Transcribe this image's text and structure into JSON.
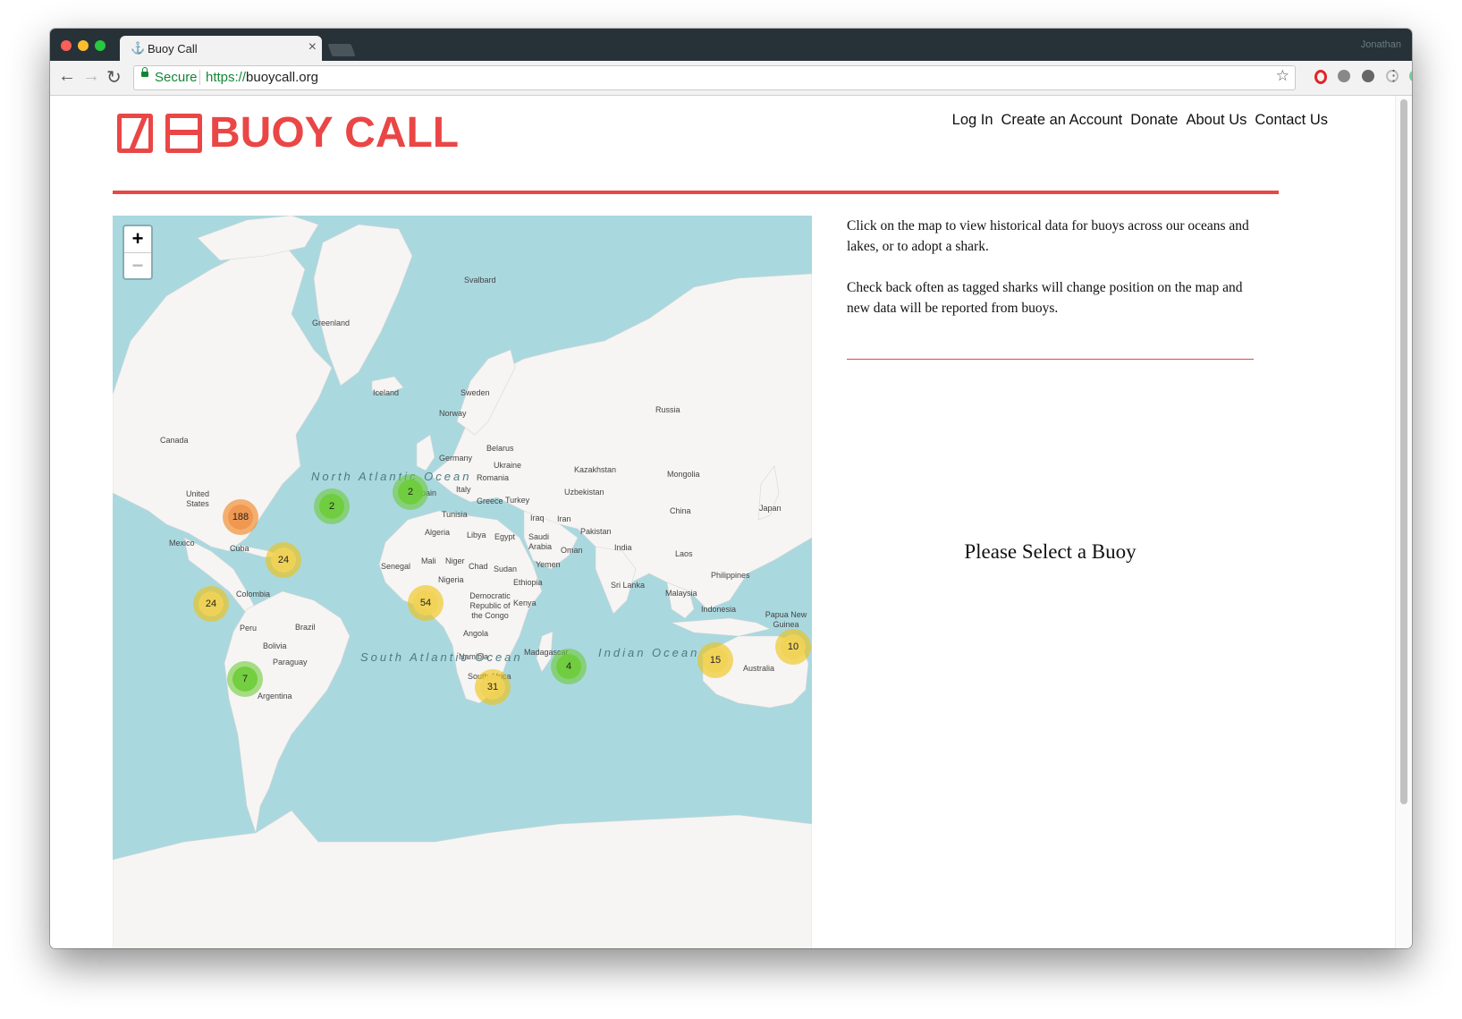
{
  "browser": {
    "tab_title": "Buoy Call",
    "secure_label": "Secure",
    "url_scheme": "https://",
    "url_host": "buoycall.org",
    "profile_name": "Jonathan"
  },
  "header": {
    "logo_text": "BUOY CALL",
    "nav": [
      "Log In",
      "Create an Account",
      "Donate",
      "About Us",
      "Contact Us"
    ],
    "accent_color": "#ea4646"
  },
  "map": {
    "zoom_in": "+",
    "zoom_out": "−",
    "labels": [
      "Svalbard",
      "Greenland",
      "Iceland",
      "Sweden",
      "Norway",
      "Russia",
      "Canada",
      "Belarus",
      "Germany",
      "Ukraine",
      "Romania",
      "Kazakhstan",
      "Mongolia",
      "Italy",
      "Uzbekistan",
      "Spain",
      "Greece",
      "Turkey",
      "United States",
      "Tunisia",
      "Iraq",
      "Iran",
      "China",
      "Japan",
      "Algeria",
      "Libya",
      "Egypt",
      "Saudi Arabia",
      "Pakistan",
      "Mexico",
      "Cuba",
      "Oman",
      "India",
      "Laos",
      "Senegal",
      "Mali",
      "Niger",
      "Chad",
      "Sudan",
      "Yemen",
      "Colombia",
      "Nigeria",
      "Ethiopia",
      "Sri Lanka",
      "Philippines",
      "Malaysia",
      "Democratic Republic of the Congo",
      "Kenya",
      "Indonesia",
      "Papua New Guinea",
      "Peru",
      "Brazil",
      "Angola",
      "Bolivia",
      "Paraguay",
      "Namibia",
      "Madagascar",
      "Australia",
      "South Africa",
      "Argentina"
    ],
    "oceans": [
      "North Atlantic Ocean",
      "South Atlantic Ocean",
      "Indian Ocean"
    ],
    "clusters": [
      {
        "count": "188",
        "level": "orange"
      },
      {
        "count": "2",
        "level": "green"
      },
      {
        "count": "2",
        "level": "green"
      },
      {
        "count": "24",
        "level": "yellow"
      },
      {
        "count": "24",
        "level": "yellow"
      },
      {
        "count": "54",
        "level": "yellow"
      },
      {
        "count": "7",
        "level": "green"
      },
      {
        "count": "31",
        "level": "yellow"
      },
      {
        "count": "4",
        "level": "green"
      },
      {
        "count": "15",
        "level": "yellow"
      },
      {
        "count": "10",
        "level": "yellow"
      }
    ]
  },
  "sidebar": {
    "intro": "Click on the map to view historical data for buoys across our oceans and lakes, or to adopt a shark.",
    "check_back": "Check back often as tagged sharks will change position on the map and new data will be reported from buoys.",
    "select_prompt": "Please Select a Buoy"
  }
}
